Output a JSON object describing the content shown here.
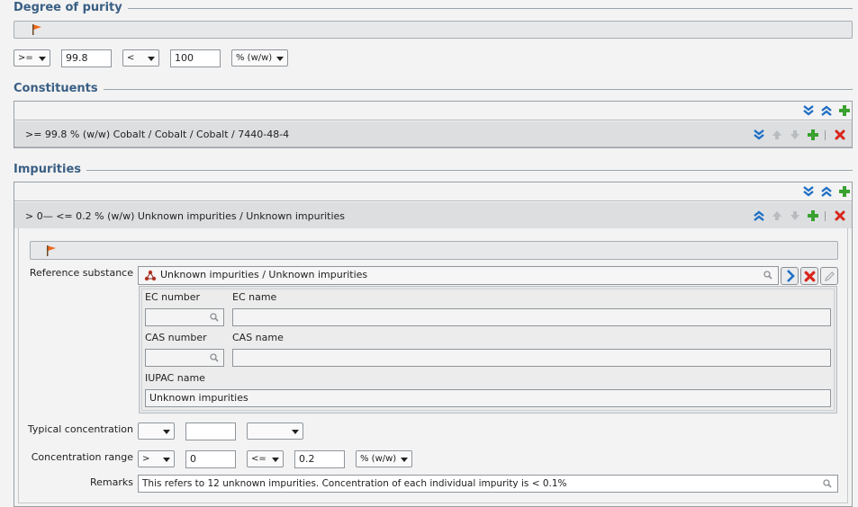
{
  "purity": {
    "title": "Degree of purity",
    "lower_qualifier": ">=",
    "lower_value": "99.8",
    "upper_qualifier": "<",
    "upper_value": "100",
    "unit": "% (w/w)"
  },
  "constituents": {
    "title": "Constituents",
    "rows": [
      {
        "summary": ">= 99.8 % (w/w) Cobalt / Cobalt / Cobalt / 7440-48-4"
      }
    ]
  },
  "impurities": {
    "title": "Impurities",
    "rows": [
      {
        "summary": "> 0— <= 0.2 % (w/w) Unknown impurities / Unknown impurities"
      }
    ],
    "detail": {
      "reference_substance_label": "Reference substance",
      "reference_substance_value": "Unknown impurities / Unknown impurities",
      "ec_number_label": "EC number",
      "ec_number_value": "",
      "ec_name_label": "EC name",
      "ec_name_value": "",
      "cas_number_label": "CAS number",
      "cas_number_value": "",
      "cas_name_label": "CAS name",
      "cas_name_value": "",
      "iupac_name_label": "IUPAC name",
      "iupac_name_value": "Unknown impurities",
      "typical_concentration_label": "Typical concentration",
      "typical_qualifier": "",
      "typical_value": "",
      "typical_unit": "",
      "concentration_range_label": "Concentration range",
      "range_lower_qualifier": ">",
      "range_lower_value": "0",
      "range_upper_qualifier": "<=",
      "range_upper_value": "0.2",
      "range_unit": "% (w/w)",
      "remarks_label": "Remarks",
      "remarks_value": "This refers to 12 unknown impurities. Concentration of each individual impurity is < 0.1%"
    }
  },
  "icons": {
    "flag": "flag-icon",
    "expand_all": "double-chevron-down-icon",
    "collapse_all": "double-chevron-up-icon",
    "add": "plus-icon",
    "move_up": "arrow-up-icon",
    "move_down": "arrow-down-icon",
    "delete": "delete-x-icon",
    "search": "magnifier-icon",
    "substance": "molecule-icon",
    "navigate": "chevron-right-icon",
    "edit": "pencil-icon"
  },
  "colors": {
    "section_title": "#3a5f84",
    "accent_blue": "#1f6fc5",
    "add_green": "#3aa12f",
    "delete_red": "#d9261c",
    "flag_orange": "#f06a1c"
  }
}
